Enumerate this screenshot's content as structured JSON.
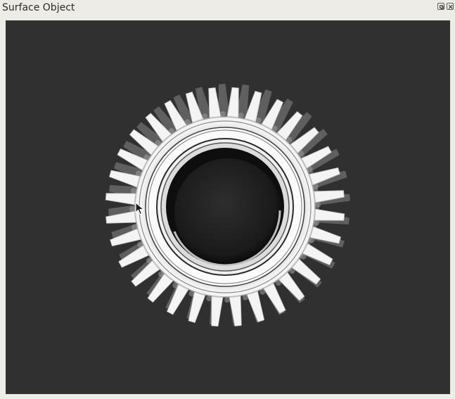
{
  "window": {
    "title": "Surface Object",
    "viewport_background": "#303030",
    "chrome_background": "#edebe6"
  },
  "buttons": {
    "float_icon": "float-restore-icon",
    "close_icon": "close-icon"
  },
  "scene": {
    "object": "gear",
    "tooth_count": 32,
    "material_color": "#f4f4f4"
  }
}
